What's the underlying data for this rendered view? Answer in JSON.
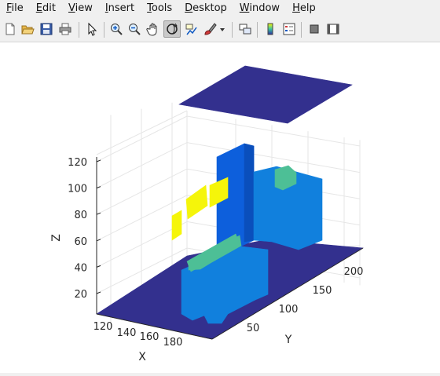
{
  "menu": [
    {
      "pre": "",
      "acc": "F",
      "post": "ile"
    },
    {
      "pre": "",
      "acc": "E",
      "post": "dit"
    },
    {
      "pre": "",
      "acc": "V",
      "post": "iew"
    },
    {
      "pre": "",
      "acc": "I",
      "post": "nsert"
    },
    {
      "pre": "",
      "acc": "T",
      "post": "ools"
    },
    {
      "pre": "",
      "acc": "D",
      "post": "esktop"
    },
    {
      "pre": "",
      "acc": "W",
      "post": "indow"
    },
    {
      "pre": "",
      "acc": "H",
      "post": "elp"
    }
  ],
  "toolbar": {
    "buttons": [
      "new-figure-icon",
      "open-icon",
      "save-icon",
      "print-icon",
      "pointer-icon",
      "zoom-in-icon",
      "zoom-out-icon",
      "pan-icon",
      "rotate-3d-icon",
      "data-cursor-icon",
      "brush-icon",
      "brush-dropdown-icon",
      "link-plot-icon",
      "colorbar-icon",
      "legend-icon",
      "hide-plot-tools-icon",
      "show-plot-tools-icon"
    ],
    "active": "rotate-3d-icon"
  },
  "plot": {
    "z_ticks": [
      "20",
      "40",
      "60",
      "80",
      "100",
      "120"
    ],
    "x_ticks": [
      "120",
      "140",
      "160",
      "180"
    ],
    "y_ticks": [
      "50",
      "100",
      "150",
      "200"
    ],
    "x_label": "X",
    "y_label": "Y",
    "z_label": "Z"
  },
  "colors": {
    "navy": "#33308e",
    "blue": "#0d5fdc",
    "mid_blue": "#1180dd",
    "teal": "#4dbf96",
    "yellow": "#f5f50a",
    "grid": "#e6e6e6",
    "axis": "#262626"
  }
}
